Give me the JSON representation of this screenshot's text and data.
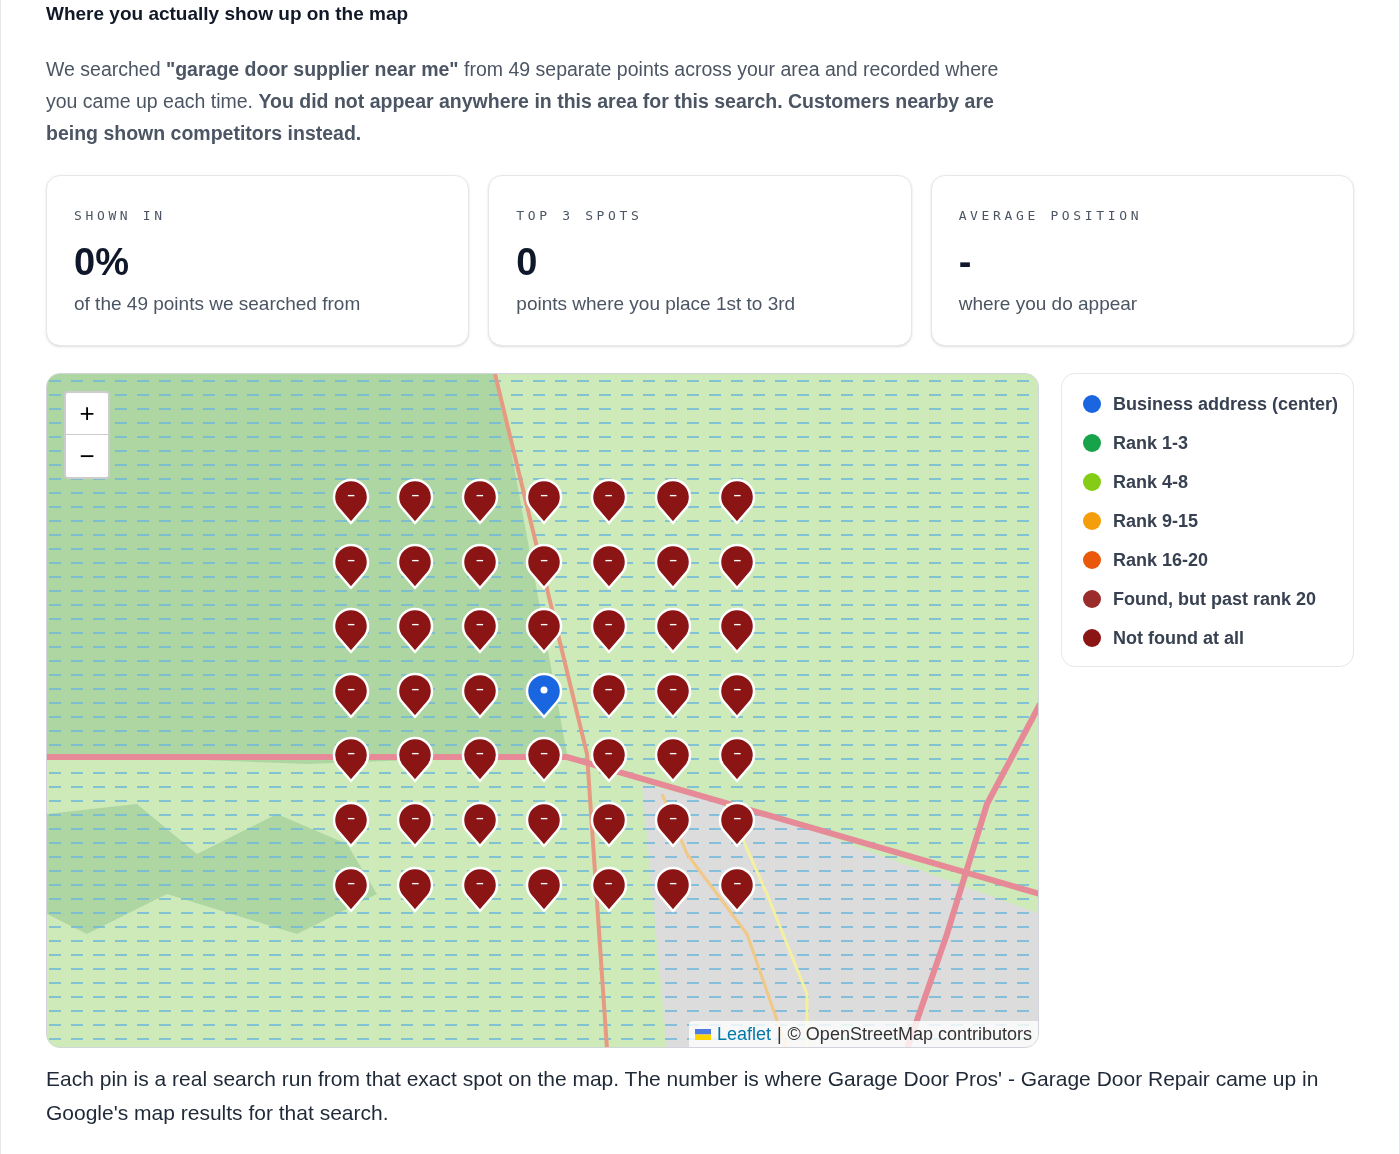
{
  "section_title": "Where you actually show up on the map",
  "intro": "We searched **\"garage door supplier near me\"** from 49 separate points across your area and recorded where you came up each time. **You did not appear anywhere in this area for this search. Customers nearby are being shown competitors instead.**",
  "stats": [
    {
      "label": "SHOWN IN",
      "value": "0%",
      "caption": "of the 49 points we searched from"
    },
    {
      "label": "TOP 3 SPOTS",
      "value": "0",
      "caption": "points where you place 1st to 3rd"
    },
    {
      "label": "AVERAGE POSITION",
      "value": "-",
      "caption": "where you do appear"
    }
  ],
  "map": {
    "zoom_controls": [
      "+",
      "−"
    ],
    "attribution": {
      "link": "Leaflet",
      "separator": "|",
      "text": "© OpenStreetMap contributors"
    },
    "pins": [
      [
        {
          "kind": "rank",
          "label": "–"
        },
        {
          "kind": "rank",
          "label": "–"
        },
        {
          "kind": "rank",
          "label": "–"
        },
        {
          "kind": "rank",
          "label": "–"
        },
        {
          "kind": "rank",
          "label": "–"
        },
        {
          "kind": "rank",
          "label": "–"
        },
        {
          "kind": "rank",
          "label": "–"
        }
      ],
      [
        {
          "kind": "rank",
          "label": "–"
        },
        {
          "kind": "rank",
          "label": "–"
        },
        {
          "kind": "rank",
          "label": "–"
        },
        {
          "kind": "rank",
          "label": "–"
        },
        {
          "kind": "rank",
          "label": "–"
        },
        {
          "kind": "rank",
          "label": "–"
        },
        {
          "kind": "rank",
          "label": "–"
        }
      ],
      [
        {
          "kind": "rank",
          "label": "–"
        },
        {
          "kind": "rank",
          "label": "–"
        },
        {
          "kind": "rank",
          "label": "–"
        },
        {
          "kind": "rank",
          "label": "–"
        },
        {
          "kind": "rank",
          "label": "–"
        },
        {
          "kind": "rank",
          "label": "–"
        },
        {
          "kind": "rank",
          "label": "–"
        }
      ],
      [
        {
          "kind": "rank",
          "label": "–"
        },
        {
          "kind": "rank",
          "label": "–"
        },
        {
          "kind": "rank",
          "label": "–"
        },
        {
          "kind": "center"
        },
        {
          "kind": "rank",
          "label": "–"
        },
        {
          "kind": "rank",
          "label": "–"
        },
        {
          "kind": "rank",
          "label": "–"
        }
      ],
      [
        {
          "kind": "rank",
          "label": "–"
        },
        {
          "kind": "rank",
          "label": "–"
        },
        {
          "kind": "rank",
          "label": "–"
        },
        {
          "kind": "rank",
          "label": "–"
        },
        {
          "kind": "rank",
          "label": "–"
        },
        {
          "kind": "rank",
          "label": "–"
        },
        {
          "kind": "rank",
          "label": "–"
        }
      ],
      [
        {
          "kind": "rank",
          "label": "–"
        },
        {
          "kind": "rank",
          "label": "–"
        },
        {
          "kind": "rank",
          "label": "–"
        },
        {
          "kind": "rank",
          "label": "–"
        },
        {
          "kind": "rank",
          "label": "–"
        },
        {
          "kind": "rank",
          "label": "–"
        },
        {
          "kind": "rank",
          "label": "–"
        }
      ],
      [
        {
          "kind": "rank",
          "label": "–"
        },
        {
          "kind": "rank",
          "label": "–"
        },
        {
          "kind": "rank",
          "label": "–"
        },
        {
          "kind": "rank",
          "label": "–"
        },
        {
          "kind": "rank",
          "label": "–"
        },
        {
          "kind": "rank",
          "label": "–"
        },
        {
          "kind": "rank",
          "label": "–"
        }
      ]
    ]
  },
  "legend": [
    {
      "label": "Business address (center)",
      "color": "#1a66e0"
    },
    {
      "label": "Rank 1-3",
      "color": "#16a34a"
    },
    {
      "label": "Rank 4-8",
      "color": "#84cc16"
    },
    {
      "label": "Rank 9-15",
      "color": "#f59e0b"
    },
    {
      "label": "Rank 16-20",
      "color": "#ea580c"
    },
    {
      "label": "Found, but past rank 20",
      "color": "#9b2c2c"
    },
    {
      "label": "Not found at all",
      "color": "#8b1414"
    }
  ],
  "footnote": "Each pin is a real search run from that exact spot on the map. The number is where Garage Door Pros' - Garage Door Repair came up in Google's map results for that search."
}
